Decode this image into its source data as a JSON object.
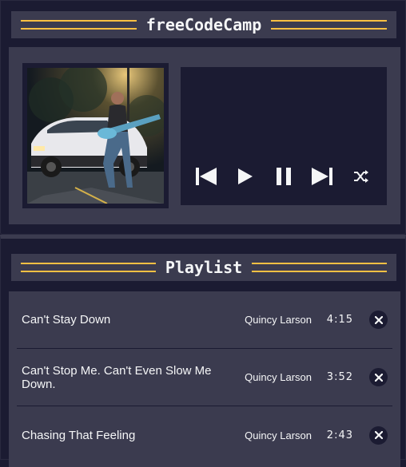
{
  "app": {
    "title": "freeCodeCamp"
  },
  "playlist": {
    "title": "Playlist",
    "songs": [
      {
        "title": "Can't Stay Down",
        "artist": "Quincy Larson",
        "duration": "4:15"
      },
      {
        "title": "Can't Stop Me. Can't Even Slow Me Down.",
        "artist": "Quincy Larson",
        "duration": "3:52"
      },
      {
        "title": "Chasing That Feeling",
        "artist": "Quincy Larson",
        "duration": "2:43"
      }
    ]
  },
  "controls": [
    "previous-icon",
    "play-icon",
    "pause-icon",
    "next-icon",
    "shuffle-icon"
  ],
  "colors": {
    "bg": "#1b1b32",
    "panel": "#3b3b4f",
    "accent": "#fec043",
    "text": "#f5f6f7"
  }
}
